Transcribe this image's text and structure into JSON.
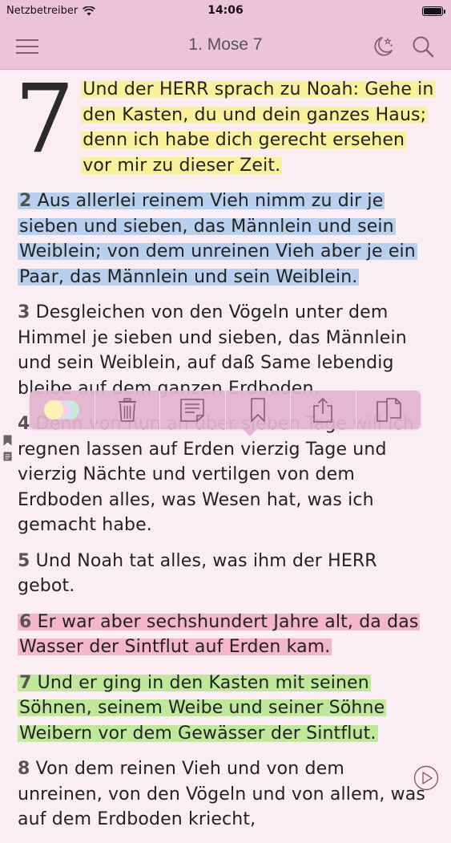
{
  "status_bar": {
    "carrier": "Netzbetreiber",
    "time": "14:06"
  },
  "nav": {
    "title": "1. Mose 7"
  },
  "chapter": {
    "number": "7"
  },
  "verses": [
    {
      "num": "",
      "text": "Und der HERR sprach zu Noah: Gehe in den Kasten, du und dein ganzes Haus; denn ich habe dich gerecht ersehen vor mir zu dieser Zeit.",
      "highlight": "yellow"
    },
    {
      "num": "2",
      "text": "Aus allerlei reinem Vieh nimm zu dir je sieben und sieben, das Männlein und sein Weiblein; von dem unreinen Vieh aber je ein Paar, das Männlein und sein Weiblein.",
      "highlight": "blue"
    },
    {
      "num": "3",
      "text": "Desgleichen von den Vögeln unter dem Himmel je sieben und sieben, das Männlein und sein Weiblein, auf daß Same lebendig bleibe auf dem ganzen Erdboden.",
      "highlight": "none"
    },
    {
      "num": "4",
      "text": "Denn von nun an über sieben Tage will ich regnen lassen auf Erden vierzig Tage und vierzig Nächte und vertilgen von dem Erdboden alles, was Wesen hat, was ich gemacht habe.",
      "highlight": "none"
    },
    {
      "num": "5",
      "text": "Und Noah tat alles, was ihm der HERR gebot.",
      "highlight": "none"
    },
    {
      "num": "6",
      "text": "Er war aber sechshundert Jahre alt, da das Wasser der Sintflut auf Erden kam.",
      "highlight": "pink"
    },
    {
      "num": "7",
      "text": "Und er ging in den Kasten mit seinen Söhnen, seinem Weibe und seiner Söhne Weibern vor dem Gewässer der Sintflut.",
      "highlight": "green"
    },
    {
      "num": "8",
      "text": "Von dem reinen Vieh und von dem unreinen, von den Vögeln und von allem, was auf dem Erdboden kriecht,",
      "highlight": "none"
    }
  ],
  "toolbar": {
    "items": [
      "color-picker",
      "delete",
      "note",
      "bookmark",
      "share",
      "copy"
    ]
  },
  "colors": {
    "bar_bg": "#ecc4d8",
    "page_bg": "#fbeef3",
    "yellow": "#fbf19a",
    "blue": "#b8d0ef",
    "pink": "#f5b6cd",
    "green": "#bfe89a",
    "icon": "#8a5a75"
  }
}
